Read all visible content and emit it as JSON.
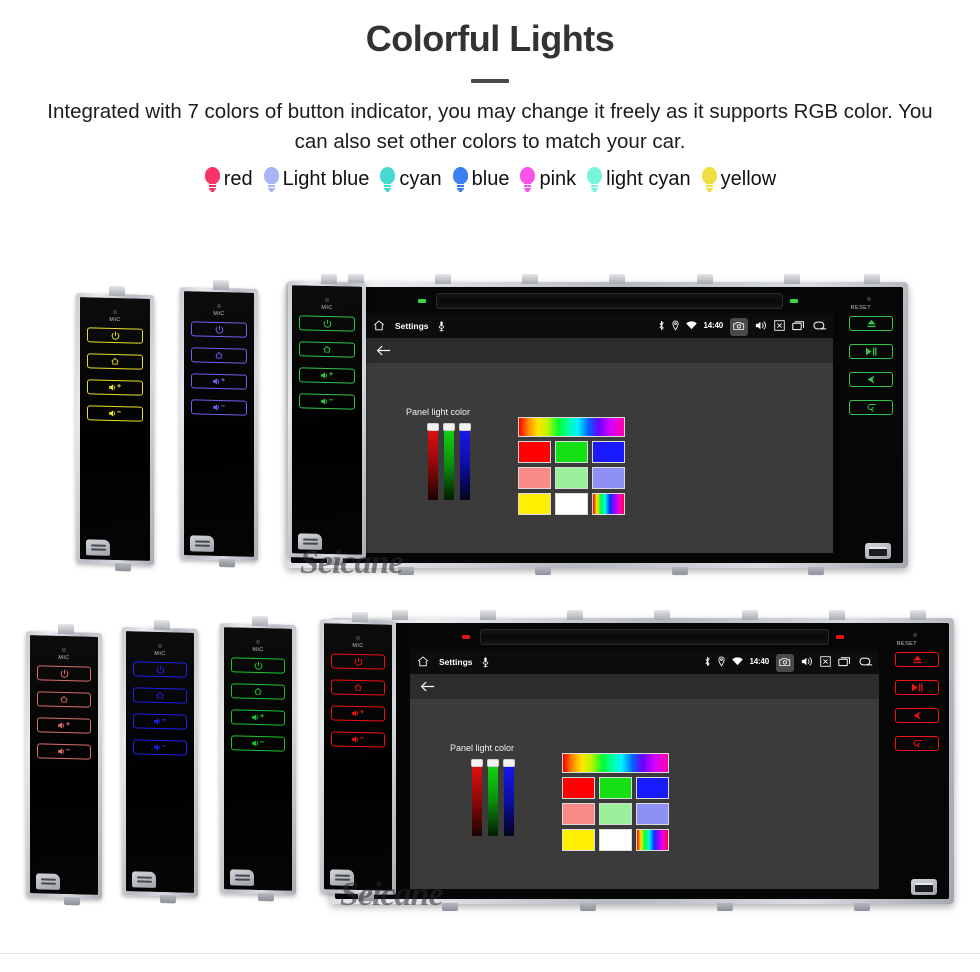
{
  "header": {
    "title": "Colorful Lights",
    "subtitle": "Integrated with 7 colors of button indicator, you may change it freely as it supports RGB color. You can also set other colors to match your car.",
    "divider_color": "#4a4a4a",
    "title_color": "#333333"
  },
  "legend": {
    "items": [
      {
        "label": "red",
        "color": "#fb3364",
        "icon": "bulb-icon"
      },
      {
        "label": "Light blue",
        "color": "#a8b4f7",
        "icon": "bulb-icon"
      },
      {
        "label": "cyan",
        "color": "#45d9d2",
        "icon": "bulb-icon"
      },
      {
        "label": "blue",
        "color": "#3b7ff0",
        "icon": "bulb-icon"
      },
      {
        "label": "pink",
        "color": "#f953e8",
        "icon": "bulb-icon"
      },
      {
        "label": "light cyan",
        "color": "#78f5dc",
        "icon": "bulb-icon"
      },
      {
        "label": "yellow",
        "color": "#f0de43",
        "icon": "bulb-icon"
      }
    ]
  },
  "watermark": {
    "text": "Seicane"
  },
  "android_ui": {
    "status_bar": {
      "home_icon": "home-icon",
      "title": "Settings",
      "mic_icon": "microphone-icon",
      "bluetooth_icon": "bluetooth-icon",
      "location_icon": "location-icon",
      "wifi_icon": "wifi-icon",
      "clock": "14:40",
      "camera_icon": "camera-icon",
      "volume_icon": "volume-icon",
      "close_icon": "close-box-icon",
      "recents_icon": "recents-icon",
      "back_icon": "back-arrow-icon"
    },
    "action_bar": {
      "back_icon": "back-arrow-icon"
    },
    "content": {
      "panel_label": "Panel light color",
      "sliders": [
        {
          "name": "red-slider",
          "channel": "R",
          "value": 100
        },
        {
          "name": "green-slider",
          "channel": "G",
          "value": 100
        },
        {
          "name": "blue-slider",
          "channel": "B",
          "value": 100
        }
      ],
      "swatch_rows": [
        [
          {
            "name": "spectrum-bar",
            "color": "rainbow-h"
          }
        ],
        [
          {
            "name": "swatch-red",
            "color": "#ff0000"
          },
          {
            "name": "swatch-green",
            "color": "#13e113"
          },
          {
            "name": "swatch-blue",
            "color": "#1a1aff"
          }
        ],
        [
          {
            "name": "swatch-salmon",
            "color": "#fa8a87"
          },
          {
            "name": "swatch-lightgreen",
            "color": "#9bf09b"
          },
          {
            "name": "swatch-periwinkle",
            "color": "#8f90f5"
          }
        ],
        [
          {
            "name": "swatch-yellow",
            "color": "#ffef00"
          },
          {
            "name": "swatch-white",
            "color": "#ffffff"
          },
          {
            "name": "swatch-rainbow",
            "color": "rainbow-s"
          }
        ]
      ]
    }
  },
  "device_groups": [
    {
      "name": "top-device-group",
      "side_panels": [
        {
          "name": "side-panel-yellow",
          "color": "#e8e126"
        },
        {
          "name": "side-panel-violet",
          "color": "#6b63f0"
        },
        {
          "name": "side-panel-green",
          "color": "#2fc64a"
        }
      ],
      "head_unit": {
        "name": "head-unit-green",
        "button_color": "#2fc64a",
        "led_color": "#34d44a",
        "left_label": "MIC",
        "right_label": "RESET",
        "left_buttons": [
          "power-icon",
          "home-icon",
          "volume-up-icon",
          "volume-down-icon"
        ],
        "right_buttons": [
          "eject-icon",
          "play-pause-icon",
          "navigation-icon",
          "return-icon"
        ]
      }
    },
    {
      "name": "bottom-device-group",
      "side_panels": [
        {
          "name": "side-panel-salmon",
          "color": "#d9706a"
        },
        {
          "name": "side-panel-blue",
          "color": "#1f1fee"
        },
        {
          "name": "side-panel-green",
          "color": "#17c72b"
        },
        {
          "name": "side-panel-red",
          "color": "#f01010"
        }
      ],
      "head_unit": {
        "name": "head-unit-red",
        "button_color": "#f01010",
        "led_color": "#e01414",
        "left_label": "MIC",
        "right_label": "RESET",
        "left_buttons": [
          "power-icon",
          "home-icon",
          "volume-up-icon",
          "volume-down-icon"
        ],
        "right_buttons": [
          "eject-icon",
          "play-pause-icon",
          "navigation-icon",
          "return-icon"
        ]
      }
    }
  ],
  "panel_labels": {
    "mic": "MIC",
    "reset": "RESET"
  }
}
